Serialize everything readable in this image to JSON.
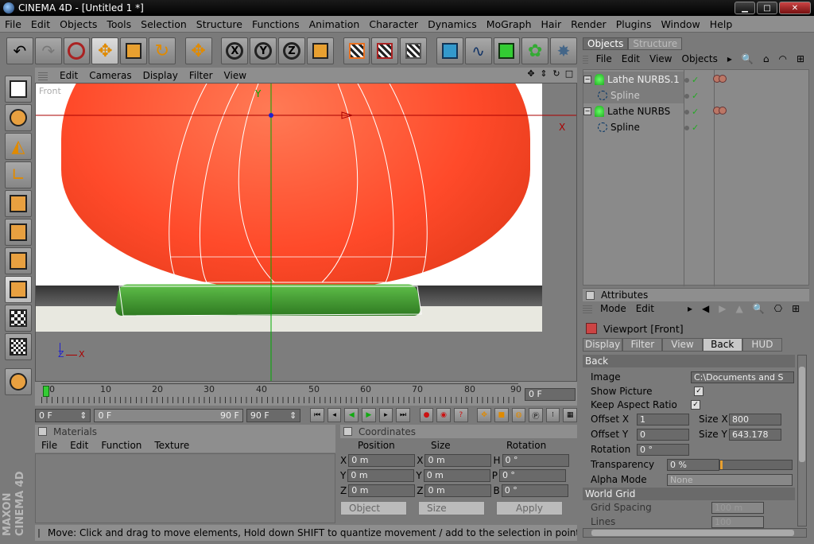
{
  "window": {
    "title": "CINEMA 4D - [Untitled 1 *]"
  },
  "menubar": [
    "File",
    "Edit",
    "Objects",
    "Tools",
    "Selection",
    "Structure",
    "Functions",
    "Animation",
    "Character",
    "Dynamics",
    "MoGraph",
    "Hair",
    "Render",
    "Plugins",
    "Window",
    "Help"
  ],
  "toolbar": {
    "axis_x": "X",
    "axis_y": "Y",
    "axis_z": "Z"
  },
  "viewport": {
    "menu": [
      "Edit",
      "Cameras",
      "Display",
      "Filter",
      "View"
    ],
    "label": "Front",
    "axis_labels": {
      "y": "Y",
      "x": "X",
      "gizmo_z": "Z",
      "gizmo_x": "X"
    }
  },
  "timeline": {
    "ticks": [
      "0",
      "10",
      "20",
      "30",
      "40",
      "50",
      "60",
      "70",
      "80",
      "90"
    ],
    "current_frame": "0 F"
  },
  "transport": {
    "start": "0 F",
    "range_start": "0 F",
    "range_end": "90 F",
    "end": "90 F"
  },
  "materials": {
    "title": "Materials",
    "menu": [
      "File",
      "Edit",
      "Function",
      "Texture"
    ]
  },
  "coordinates": {
    "title": "Coordinates",
    "headers": [
      "Position",
      "Size",
      "Rotation"
    ],
    "rows": [
      {
        "pos_axis": "X",
        "pos": "0 m",
        "size_axis": "X",
        "size": "0 m",
        "rot_axis": "H",
        "rot": "0 °"
      },
      {
        "pos_axis": "Y",
        "pos": "0 m",
        "size_axis": "Y",
        "size": "0 m",
        "rot_axis": "P",
        "rot": "0 °"
      },
      {
        "pos_axis": "Z",
        "pos": "0 m",
        "size_axis": "Z",
        "size": "0 m",
        "rot_axis": "B",
        "rot": "0 °"
      }
    ],
    "mode_select": "Object",
    "size_select": "Size",
    "apply_label": "Apply"
  },
  "status": "Move: Click and drag to move elements, Hold down SHIFT to quantize movement / add to the selection in point mod",
  "objects_panel": {
    "tabs": [
      "Objects",
      "Structure"
    ],
    "menu": [
      "File",
      "Edit",
      "View",
      "Objects"
    ],
    "items": [
      {
        "label": "Lathe NURBS.1",
        "type": "nurbs"
      },
      {
        "label": "Spline",
        "type": "spline"
      },
      {
        "label": "Lathe NURBS",
        "type": "nurbs"
      },
      {
        "label": "Spline",
        "type": "spline"
      }
    ],
    "checkmark": "✓"
  },
  "attributes": {
    "title": "Attributes",
    "menu": [
      "Mode",
      "Edit"
    ],
    "object_title": "Viewport [Front]",
    "tabs": [
      "Display",
      "Filter",
      "View",
      "Back",
      "HUD"
    ],
    "active_tab": "Back",
    "section_back": "Back",
    "image_label": "Image",
    "image_value": "C:\\Documents and S",
    "show_picture_label": "Show Picture",
    "keep_aspect_label": "Keep Aspect Ratio",
    "offset_x_label": "Offset X",
    "offset_x": "1",
    "size_x_label": "Size X",
    "size_x": "800",
    "offset_y_label": "Offset Y",
    "offset_y": "0",
    "size_y_label": "Size Y",
    "size_y": "643.178",
    "rotation_label": "Rotation",
    "rotation": "0 °",
    "transparency_label": "Transparency",
    "transparency": "0 %",
    "alpha_mode_label": "Alpha Mode",
    "alpha_mode": "None",
    "section_world_grid": "World Grid",
    "grid_spacing_label": "Grid Spacing",
    "grid_spacing": "100 m",
    "lines_label": "Lines",
    "lines": "100",
    "check": "✓"
  },
  "branding": "MAXON CINEMA 4D"
}
